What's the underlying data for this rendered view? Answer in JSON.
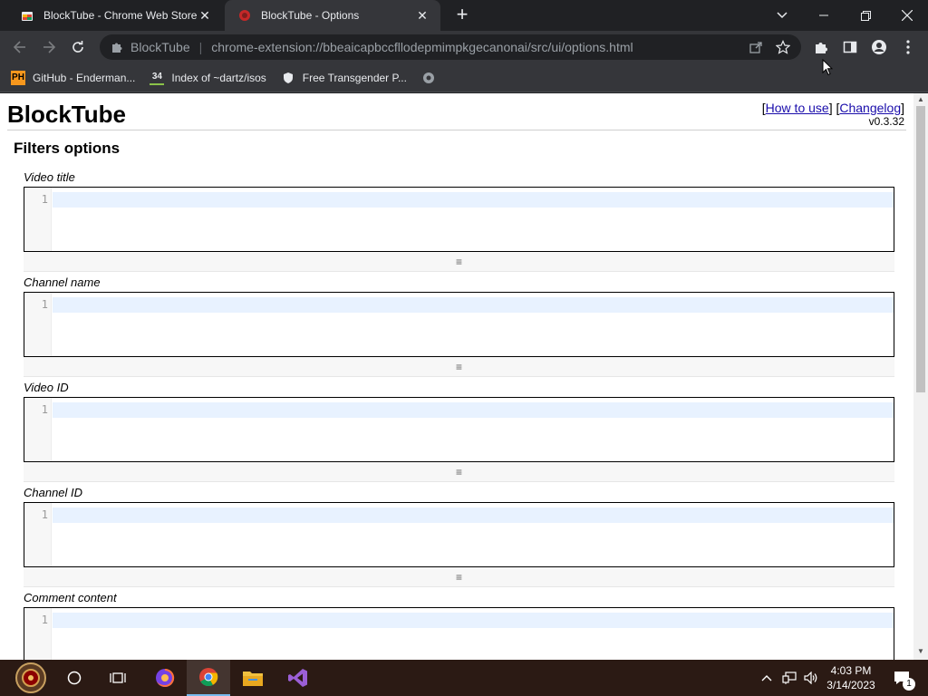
{
  "browser": {
    "tabs": [
      {
        "title": "BlockTube - Chrome Web Store"
      },
      {
        "title": "BlockTube - Options"
      }
    ],
    "origin_label": "BlockTube",
    "url": "chrome-extension://bbeaicapbccfllodepmimpkgecanonai/src/ui/options.html",
    "bookmarks": [
      {
        "icon_text": "PH",
        "label": "GitHub - Enderman..."
      },
      {
        "icon_text": "34",
        "label": "Index of ~dartz/isos"
      },
      {
        "icon_text": "",
        "label": "Free Transgender P..."
      },
      {
        "icon_text": "",
        "label": ""
      }
    ]
  },
  "page": {
    "title": "BlockTube",
    "link_how_to_use": "How to use",
    "link_changelog": "Changelog",
    "version": "v0.3.32",
    "section_title": "Filters options",
    "filters": [
      {
        "label": "Video title",
        "line_number": "1"
      },
      {
        "label": "Channel name",
        "line_number": "1"
      },
      {
        "label": "Video ID",
        "line_number": "1"
      },
      {
        "label": "Channel ID",
        "line_number": "1"
      },
      {
        "label": "Comment content",
        "line_number": "1"
      }
    ],
    "grip_glyph": "≡"
  },
  "taskbar": {
    "time": "4:03 PM",
    "date": "3/14/2023",
    "notification_count": "1"
  },
  "colors": {
    "browser_frame": "#202124",
    "toolbar": "#35363a",
    "link": "#1a0dab",
    "active_line": "#e8f2ff",
    "taskbar": "#2b1a14"
  }
}
